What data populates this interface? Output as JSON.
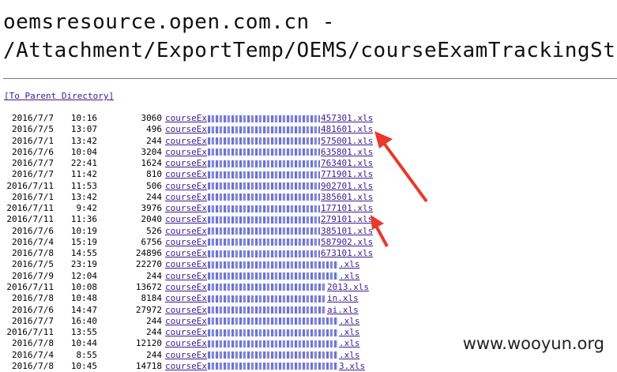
{
  "header": {
    "line1": "oemsresource.open.com.cn -",
    "line2": "/Attachment/ExportTemp/OEMS/courseExamTrackingSta"
  },
  "parent_link": "[To Parent Directory]",
  "files": [
    {
      "date": "2016/7/7",
      "time": "10:16",
      "size": "3060",
      "prefix": "courseEx",
      "suffix": "457301.xls"
    },
    {
      "date": "2016/7/5",
      "time": "13:07",
      "size": "496",
      "prefix": "courseEx",
      "suffix": "481601.xls"
    },
    {
      "date": "2016/7/1",
      "time": "13:42",
      "size": "244",
      "prefix": "courseEx",
      "suffix": "575001.xls"
    },
    {
      "date": "2016/7/6",
      "time": "10:04",
      "size": "3204",
      "prefix": "courseEx",
      "suffix": "635801.xls"
    },
    {
      "date": "2016/7/7",
      "time": "22:41",
      "size": "1624",
      "prefix": "courseEx",
      "suffix": "763401.xls"
    },
    {
      "date": "2016/7/7",
      "time": "11:42",
      "size": "810",
      "prefix": "courseEx",
      "suffix": "771901.xls"
    },
    {
      "date": "2016/7/11",
      "time": "11:53",
      "size": "506",
      "prefix": "courseEx",
      "suffix": "902701.xls"
    },
    {
      "date": "2016/7/1",
      "time": "13:42",
      "size": "244",
      "prefix": "courseEx",
      "suffix": "385601.xls"
    },
    {
      "date": "2016/7/11",
      "time": "9:42",
      "size": "3976",
      "prefix": "courseEx",
      "suffix": "177101.xls"
    },
    {
      "date": "2016/7/11",
      "time": "11:36",
      "size": "2040",
      "prefix": "courseEx",
      "suffix": "279101.xls"
    },
    {
      "date": "2016/7/6",
      "time": "10:19",
      "size": "526",
      "prefix": "courseEx",
      "suffix": "385101.xls"
    },
    {
      "date": "2016/7/4",
      "time": "15:19",
      "size": "6756",
      "prefix": "courseEx",
      "suffix": "587902.xls"
    },
    {
      "date": "2016/7/8",
      "time": "14:55",
      "size": "24896",
      "prefix": "courseEx",
      "suffix": "673101.xls"
    },
    {
      "date": "2016/7/5",
      "time": "23:19",
      "size": "22270",
      "prefix": "courseEx",
      "suffix": ".xls"
    },
    {
      "date": "2016/7/9",
      "time": "12:04",
      "size": "244",
      "prefix": "courseEx",
      "suffix": ".xls"
    },
    {
      "date": "2016/7/11",
      "time": "10:08",
      "size": "13672",
      "prefix": "courseEx",
      "suffix": "2013.xls"
    },
    {
      "date": "2016/7/8",
      "time": "10:48",
      "size": "8184",
      "prefix": "courseEx",
      "suffix": "in.xls"
    },
    {
      "date": "2016/7/6",
      "time": "14:47",
      "size": "27972",
      "prefix": "courseEx",
      "suffix": "ai.xls"
    },
    {
      "date": "2016/7/7",
      "time": "16:40",
      "size": "244",
      "prefix": "courseEx",
      "suffix": ".xls"
    },
    {
      "date": "2016/7/11",
      "time": "13:55",
      "size": "244",
      "prefix": "courseEx",
      "suffix": ".xls"
    },
    {
      "date": "2016/7/8",
      "time": "10:44",
      "size": "12120",
      "prefix": "courseEx",
      "suffix": ".xls"
    },
    {
      "date": "2016/7/4",
      "time": "8:55",
      "size": "244",
      "prefix": "courseEx",
      "suffix": ".xls"
    },
    {
      "date": "2016/7/8",
      "time": "10:45",
      "size": "14718",
      "prefix": "courseEx",
      "suffix": "3.xls"
    }
  ],
  "watermark": "www.wooyun.org",
  "colors": {
    "link": "#3a1d8f",
    "arrow": "#e8392c"
  }
}
